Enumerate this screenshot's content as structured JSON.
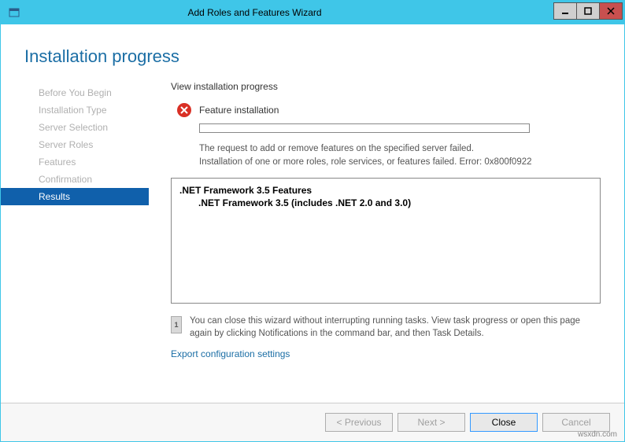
{
  "window": {
    "title": "Add Roles and Features Wizard"
  },
  "header": {
    "title": "Installation progress"
  },
  "sidebar": {
    "items": [
      {
        "label": "Before You Begin"
      },
      {
        "label": "Installation Type"
      },
      {
        "label": "Server Selection"
      },
      {
        "label": "Server Roles"
      },
      {
        "label": "Features"
      },
      {
        "label": "Confirmation"
      },
      {
        "label": "Results"
      }
    ],
    "active_index": 6
  },
  "main": {
    "subheading": "View installation progress",
    "status_label": "Feature installation",
    "error_line1": "The request to add or remove features on the specified server failed.",
    "error_line2": "Installation of one or more roles, role services, or features failed. Error: 0x800f0922",
    "features": {
      "parent": ".NET Framework 3.5 Features",
      "child": ".NET Framework 3.5 (includes .NET 2.0 and 3.0)"
    },
    "info_text": "You can close this wizard without interrupting running tasks. View task progress or open this page again by clicking Notifications in the command bar, and then Task Details.",
    "export_link": "Export configuration settings"
  },
  "footer": {
    "previous": "< Previous",
    "next": "Next >",
    "close": "Close",
    "cancel": "Cancel"
  },
  "watermark": "wsxdn.com"
}
